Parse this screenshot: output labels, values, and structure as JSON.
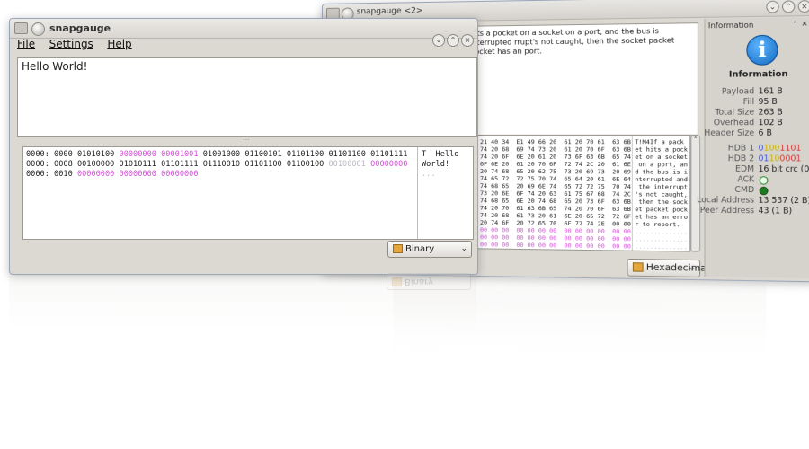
{
  "main_window": {
    "title": "snapgauge",
    "menu": {
      "file": "File",
      "settings": "Settings",
      "help": "Help"
    },
    "message_text": "Hello World!",
    "divider_mark": "...",
    "binary_rows": [
      {
        "addr": "0000: 0000",
        "bytes": [
          {
            "v": "01010100",
            "c": "normal"
          },
          {
            "v": "00000000",
            "c": "pink"
          },
          {
            "v": "00001001",
            "c": "pink"
          },
          {
            "v": "01001000",
            "c": "normal"
          },
          {
            "v": "01100101",
            "c": "normal"
          },
          {
            "v": "01101100",
            "c": "normal"
          },
          {
            "v": "01101100",
            "c": "normal"
          },
          {
            "v": "01101111",
            "c": "normal"
          }
        ],
        "ascii": "T  Hello"
      },
      {
        "addr": "0000: 0008",
        "bytes": [
          {
            "v": "00100000",
            "c": "normal"
          },
          {
            "v": "01010111",
            "c": "normal"
          },
          {
            "v": "01101111",
            "c": "normal"
          },
          {
            "v": "01110010",
            "c": "normal"
          },
          {
            "v": "01101100",
            "c": "normal"
          },
          {
            "v": "01100100",
            "c": "normal"
          },
          {
            "v": "00100001",
            "c": "dim"
          },
          {
            "v": "00000000",
            "c": "pink"
          }
        ],
        "ascii": "World!"
      },
      {
        "addr": "0000: 0010",
        "bytes": [
          {
            "v": "00000000",
            "c": "pink"
          },
          {
            "v": "00000000",
            "c": "pink"
          },
          {
            "v": "00000000",
            "c": "pink"
          }
        ],
        "ascii": "..."
      }
    ],
    "format_combo": "Binary"
  },
  "second_window": {
    "title": "snapgauge <2>",
    "message_text": "hits a pocket on a socket on a port, and the bus is interrupted rrupt's not caught, then the socket packet pocket has an port.",
    "hex_rows": [
      {
        "hex": "54 21 40 34  E1 49 66 20  61 20 70 61  63 6B",
        "ascii": "T!M4If a pack"
      },
      {
        "hex": "65 74 20 68  69 74 73 20  61 20 70 6F  63 6B",
        "ascii": "et hits a pock"
      },
      {
        "hex": "65 74 20 6F  6E 20 61 20  73 6F 63 6B  65 74",
        "ascii": "et on a socket"
      },
      {
        "hex": "20 6F 6E 20  61 20 70 6F  72 74 2C 20  61 6E",
        "ascii": " on a port, an"
      },
      {
        "hex": "64 20 74 68  65 20 62 75  73 20 69 73  20 69",
        "ascii": "d the bus is i"
      },
      {
        "hex": "6E 74 65 72  72 75 70 74  65 64 20 61  6E 64",
        "ascii": "nterrupted and"
      },
      {
        "hex": "20 74 68 65  20 69 6E 74  65 72 72 75  70 74",
        "ascii": " the interrupt"
      },
      {
        "hex": "27 73 20 6E  6F 74 20 63  61 75 67 68  74 2C",
        "ascii": "'s not caught,"
      },
      {
        "hex": "20 74 68 65  6E 20 74 68  65 20 73 6F  63 6B",
        "ascii": " then the sock"
      },
      {
        "hex": "65 74 20 70  61 63 6B 65  74 20 70 6F  63 6B",
        "ascii": "et packet pock"
      },
      {
        "hex": "65 74 20 68  61 73 20 61  6E 20 65 72  72 6F",
        "ascii": "et has an erro"
      },
      {
        "hex": "72 20 74 6F  20 72 65 70  6F 72 74 2E  00 00",
        "ascii": "r to report."
      },
      {
        "hex": "00 00 00 00  00 00 00 00  00 00 00 00  00 00",
        "ascii": "..............",
        "pink": true
      },
      {
        "hex": "00 00 00 00  00 00 00 00  00 00 00 00  00 00",
        "ascii": "..............",
        "pink": true
      },
      {
        "hex": "00 00 00 00  00 00 00 00  00 00 00 00  00 00",
        "ascii": "..............",
        "pink": true
      }
    ],
    "format_combo": "Hexadecimal"
  },
  "info_panel": {
    "panel_title": "Information",
    "heading": "Information",
    "icon_letter": "i",
    "payload_label": "Payload",
    "payload_value": "161 B",
    "fill_label": "Fill",
    "fill_value": "95 B",
    "total_label": "Total Size",
    "total_value": "263 B",
    "overhead_label": "Overhead",
    "overhead_value": "102 B",
    "header_label": "Header Size",
    "header_value": "6 B",
    "hdb1_label": "HDB 1",
    "hdb1_a": "0",
    "hdb1_b": "100",
    "hdb1_c": "1101",
    "hdb2_label": "HDB 2",
    "hdb2_a": "01",
    "hdb2_b": "10",
    "hdb2_c": "0001",
    "edm_label": "EDM",
    "edm_value": "16 bit crc (0 B)",
    "ack_label": "ACK",
    "cmd_label": "CMD",
    "local_label": "Local Address",
    "local_value": "13 537 (2 B)",
    "peer_label": "Peer Address",
    "peer_value": "43 (1 B)",
    "colors": {
      "ack": "#3dbf3d",
      "cmd": "#1f7a1f",
      "accent": "#1e88d8"
    }
  }
}
